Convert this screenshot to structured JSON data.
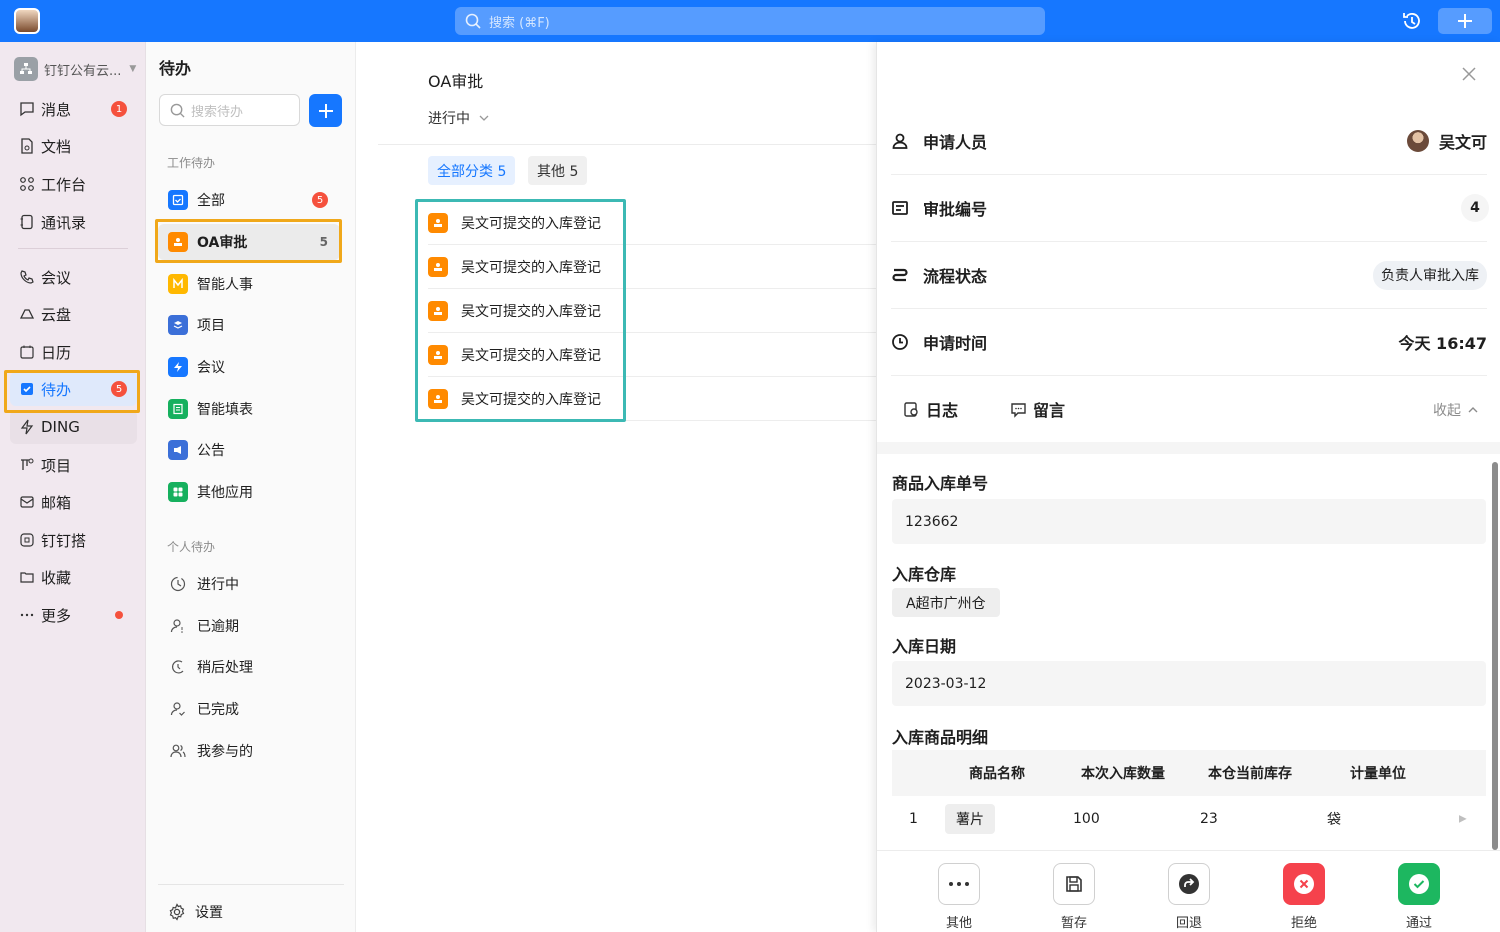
{
  "topbar": {
    "search_placeholder": "搜索 (⌘F)"
  },
  "leftnav": {
    "org_name": "钉钉公有云...",
    "items": [
      {
        "label": "消息",
        "badge": "1"
      },
      {
        "label": "文档"
      },
      {
        "label": "工作台"
      },
      {
        "label": "通讯录"
      },
      {
        "label": "会议"
      },
      {
        "label": "云盘"
      },
      {
        "label": "日历"
      },
      {
        "label": "待办",
        "badge": "5"
      },
      {
        "label": "DING"
      },
      {
        "label": "项目"
      },
      {
        "label": "邮箱"
      },
      {
        "label": "钉钉搭"
      },
      {
        "label": "收藏"
      },
      {
        "label": "更多"
      }
    ]
  },
  "todo": {
    "title": "待办",
    "search_placeholder": "搜索待办",
    "work_section": "工作待办",
    "work_items": [
      {
        "label": "全部",
        "badge": "5",
        "color": "#1677ff"
      },
      {
        "label": "OA审批",
        "count": "5",
        "color": "#ff8a00"
      },
      {
        "label": "智能人事",
        "color": "#ffb800"
      },
      {
        "label": "项目",
        "color": "#3b6fd8"
      },
      {
        "label": "会议",
        "color": "#1677ff"
      },
      {
        "label": "智能填表",
        "color": "#16b05e"
      },
      {
        "label": "公告",
        "color": "#3b6fd8"
      },
      {
        "label": "其他应用",
        "color": "#16b05e"
      }
    ],
    "personal_section": "个人待办",
    "personal_items": [
      {
        "label": "进行中"
      },
      {
        "label": "已逾期"
      },
      {
        "label": "稍后处理"
      },
      {
        "label": "已完成"
      },
      {
        "label": "我参与的"
      }
    ],
    "settings_label": "设置"
  },
  "list": {
    "heading": "OA审批",
    "filter": "进行中",
    "chips": [
      "全部分类 5",
      "其他 5"
    ],
    "rows": [
      "吴文可提交的入库登记",
      "吴文可提交的入库登记",
      "吴文可提交的入库登记",
      "吴文可提交的入库登记",
      "吴文可提交的入库登记"
    ]
  },
  "detail": {
    "applicant_label": "申请人员",
    "applicant_value": "吴文可",
    "number_label": "审批编号",
    "number_value": "4",
    "status_label": "流程状态",
    "status_value": "负责人审批入库",
    "time_label": "申请时间",
    "time_value": "今天 16:47",
    "tab_log": "日志",
    "tab_comment": "留言",
    "collapse": "收起",
    "fields": {
      "order_label": "商品入库单号",
      "order_value": "123662",
      "warehouse_label": "入库仓库",
      "warehouse_value": "A超市广州仓",
      "date_label": "入库日期",
      "date_value": "2023-03-12",
      "detail_label": "入库商品明细"
    },
    "table": {
      "headers": [
        "商品名称",
        "本次入库数量",
        "本仓当前库存",
        "计量单位"
      ],
      "rows": [
        {
          "index": "1",
          "name": "薯片",
          "qty": "100",
          "stock": "23",
          "unit": "袋"
        }
      ]
    },
    "actions": [
      "其他",
      "暂存",
      "回退",
      "拒绝",
      "通过"
    ]
  }
}
